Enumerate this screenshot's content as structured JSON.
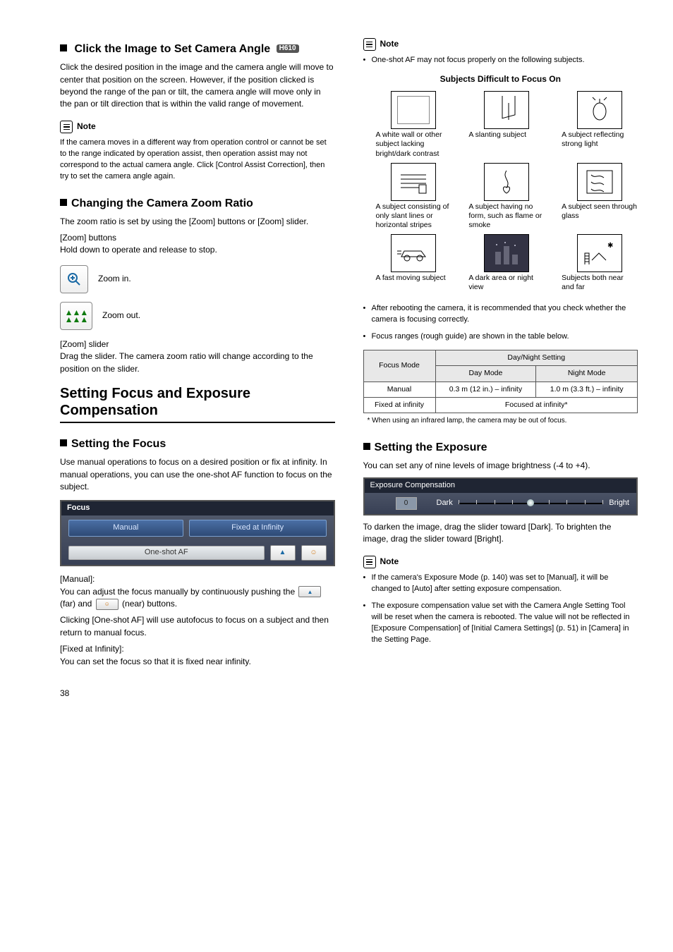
{
  "left": {
    "h1": "Click the Image to Set Camera Angle",
    "h1_badge": "H610",
    "p1": "Click the desired position in the image and the camera angle will move to center that position on the screen. However, if the position clicked is beyond the range of the pan or tilt, the camera angle will move only in the pan or tilt direction that is within the valid range of movement.",
    "note1_label": "Note",
    "note1_body": "If the camera moves in a different way from operation control or cannot be set to the range indicated by operation assist, then operation assist may not correspond to the actual camera angle. Click [Control Assist Correction], then try to set the camera angle again.",
    "h2": "Changing the Camera Zoom Ratio",
    "p2": "The zoom ratio is set by using the [Zoom] buttons or [Zoom] slider.",
    "zoom_btn_title": "[Zoom] buttons",
    "zoom_btn_desc": "Hold down to operate and release to stop.",
    "zoom_in": "Zoom in.",
    "zoom_out": "Zoom out.",
    "zoom_slider_title": "[Zoom] slider",
    "zoom_slider_desc": "Drag the slider. The camera zoom ratio will change according to the position on the slider.",
    "section2_title": "Setting Focus and Exposure Compensation",
    "h3": "Setting the Focus",
    "p3": "Use manual operations to focus on a desired position or fix at infinity. In manual operations, you can use the one-shot AF function to focus on the subject.",
    "focus_panel": {
      "title": "Focus",
      "manual": "Manual",
      "fixed": "Fixed at Infinity",
      "oneshot": "One-shot AF"
    },
    "manual_label": "[Manual]:",
    "manual_body_a": "You can adjust the focus manually by continuously pushing the ",
    "manual_far": " (far) and ",
    "manual_near": " (near) buttons.",
    "manual_body_b": "Clicking [One-shot AF] will use autofocus to focus on a subject and then return to manual focus.",
    "fixed_label": "[Fixed at Infinity]:",
    "fixed_body": "You can set the focus so that it is fixed near infinity."
  },
  "right": {
    "note_label": "Note",
    "note_bullet": "One-shot AF may not focus properly on the following subjects.",
    "grid_title": "Subjects Difficult to Focus On",
    "cells": [
      "A white wall or other subject lacking bright/dark contrast",
      "A slanting subject",
      "A subject reflecting strong light",
      "A subject consisting of only slant lines or horizontal stripes",
      "A subject having no form, such as flame or smoke",
      "A subject seen through glass",
      "A fast moving subject",
      "A dark area or night view",
      "Subjects both near and far"
    ],
    "after_reboot": "After rebooting the camera, it is recommended that you check whether the camera is focusing correctly.",
    "focus_ranges": "Focus ranges (rough guide) are shown in the table below.",
    "table": {
      "h_focus": "Focus Mode",
      "h_dn": "Day/Night Setting",
      "h_day": "Day Mode",
      "h_night": "Night Mode",
      "r1c1": "Manual",
      "r1c2": "0.3 m (12 in.) – infinity",
      "r1c3": "1.0 m (3.3 ft.) – infinity",
      "r2c1": "Fixed at infinity",
      "r2c2": "Focused at infinity*"
    },
    "footnote": "* When using an infrared lamp, the camera may be out of focus.",
    "h_exposure": "Setting the Exposure",
    "exp_p": "You can set any of nine levels of image brightness (-4 to +4).",
    "exp_panel": {
      "title": "Exposure Compensation",
      "value": "0",
      "dark": "Dark",
      "bright": "Bright"
    },
    "exp_after": "To darken the image, drag the slider toward [Dark]. To brighten the image, drag the slider toward [Bright].",
    "note3_label": "Note",
    "note3_b1": "If the camera's Exposure Mode (p. 140) was set to [Manual], it will be changed to [Auto] after setting exposure compensation.",
    "note3_b2": "The exposure compensation value set with the Camera Angle Setting Tool will be reset when the camera is rebooted. The value will not be reflected in [Exposure Compensation] of [Initial Camera Settings] (p. 51) in [Camera] in the Setting Page."
  },
  "page": "38"
}
